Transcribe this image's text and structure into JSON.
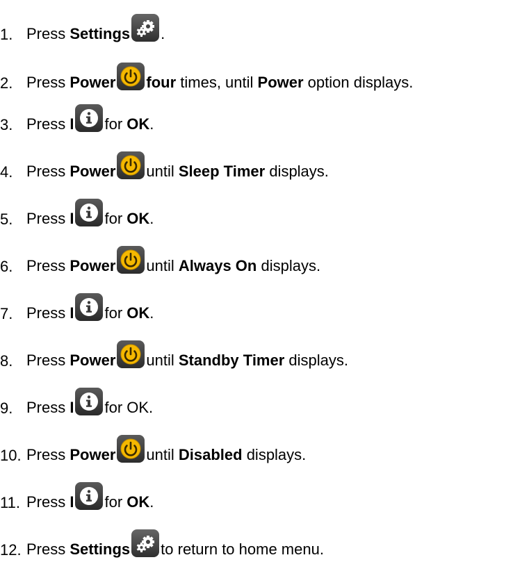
{
  "steps": [
    {
      "number": "1.",
      "parts": [
        {
          "t": "Press "
        },
        {
          "t": "Settings",
          "b": true
        },
        {
          "icon": "settings"
        },
        {
          "t": "."
        }
      ]
    },
    {
      "number": "2.",
      "parts": [
        {
          "t": "Press "
        },
        {
          "t": "Power",
          "b": true
        },
        {
          "icon": "power"
        },
        {
          "t": "four",
          "b": true
        },
        {
          "t": " times, until "
        },
        {
          "t": "Power",
          "b": true
        },
        {
          "t": " option displays."
        }
      ]
    },
    {
      "number": "3.",
      "parts": [
        {
          "t": "Press "
        },
        {
          "t": "I",
          "b": true
        },
        {
          "icon": "info"
        },
        {
          "t": "for "
        },
        {
          "t": "OK",
          "b": true
        },
        {
          "t": "."
        }
      ]
    },
    {
      "number": "4.",
      "parts": [
        {
          "t": "Press "
        },
        {
          "t": "Power",
          "b": true
        },
        {
          "icon": "power"
        },
        {
          "t": "until "
        },
        {
          "t": "Sleep Timer",
          "b": true
        },
        {
          "t": " displays."
        }
      ]
    },
    {
      "number": "5.",
      "parts": [
        {
          "t": "Press "
        },
        {
          "t": "I",
          "b": true
        },
        {
          "icon": "info"
        },
        {
          "t": "for "
        },
        {
          "t": "OK",
          "b": true
        },
        {
          "t": "."
        }
      ]
    },
    {
      "number": "6.",
      "parts": [
        {
          "t": "Press "
        },
        {
          "t": "Power",
          "b": true
        },
        {
          "icon": "power"
        },
        {
          "t": "until "
        },
        {
          "t": "Always On",
          "b": true
        },
        {
          "t": " displays."
        }
      ]
    },
    {
      "number": "7.",
      "parts": [
        {
          "t": "Press "
        },
        {
          "t": "I",
          "b": true
        },
        {
          "icon": "info"
        },
        {
          "t": "for "
        },
        {
          "t": "OK",
          "b": true
        },
        {
          "t": "."
        }
      ]
    },
    {
      "number": "8.",
      "parts": [
        {
          "t": "Press "
        },
        {
          "t": "Power",
          "b": true
        },
        {
          "icon": "power"
        },
        {
          "t": "until "
        },
        {
          "t": "Standby Timer",
          "b": true
        },
        {
          "t": " displays."
        }
      ]
    },
    {
      "number": "9.",
      "parts": [
        {
          "t": "Press "
        },
        {
          "t": "I",
          "b": true
        },
        {
          "icon": "info"
        },
        {
          "t": "for OK."
        }
      ]
    },
    {
      "number": "10.",
      "parts": [
        {
          "t": "Press "
        },
        {
          "t": "Power",
          "b": true
        },
        {
          "icon": "power"
        },
        {
          "t": "until "
        },
        {
          "t": "Disabled",
          "b": true
        },
        {
          "t": " displays."
        }
      ]
    },
    {
      "number": "11.",
      "parts": [
        {
          "t": "Press "
        },
        {
          "t": "I",
          "b": true
        },
        {
          "icon": "info"
        },
        {
          "t": "for "
        },
        {
          "t": "OK",
          "b": true
        },
        {
          "t": "."
        }
      ]
    },
    {
      "number": "12.",
      "parts": [
        {
          "t": "Press "
        },
        {
          "t": "Settings",
          "b": true
        },
        {
          "icon": "settings"
        },
        {
          "t": "to return to home menu."
        }
      ]
    }
  ],
  "icons": {
    "settings": {
      "name": "settings-gear-icon",
      "accent": "#ffffff",
      "background": "#4a4a4a"
    },
    "power": {
      "name": "power-icon",
      "accent": "#f5b800",
      "background": "#3c3c3c"
    },
    "info": {
      "name": "info-icon",
      "accent": "#ffffff",
      "background": "#3a3a3a"
    }
  }
}
